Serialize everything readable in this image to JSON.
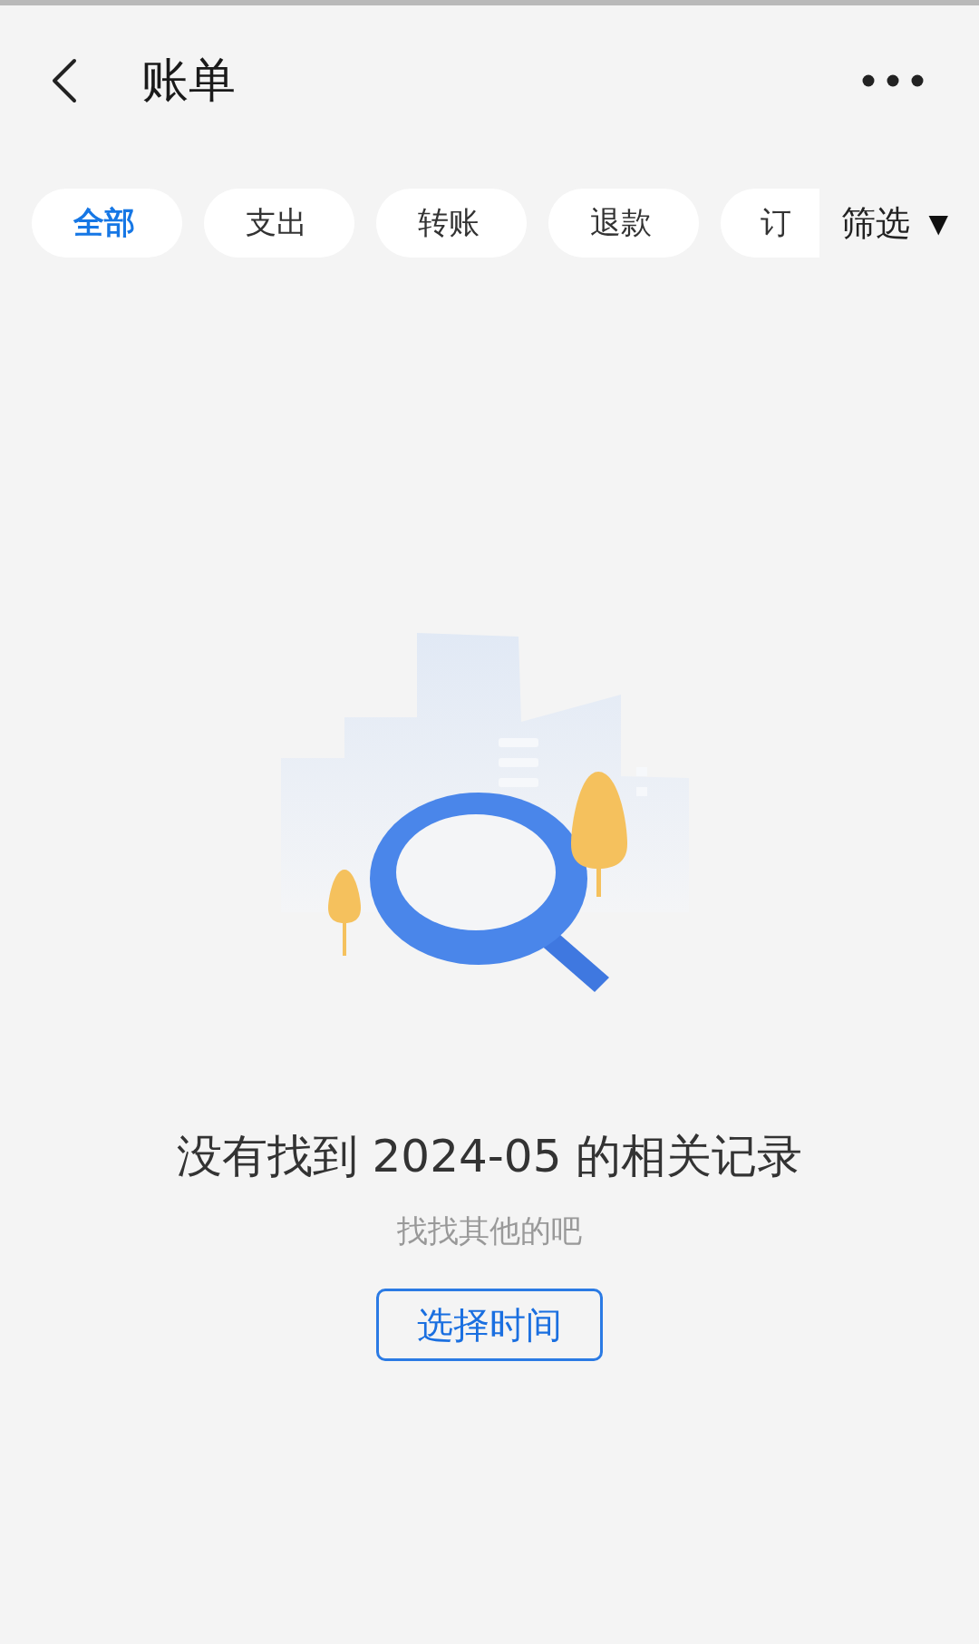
{
  "header": {
    "title": "账单"
  },
  "tabs": [
    {
      "label": "全部",
      "selected": true
    },
    {
      "label": "支出",
      "selected": false
    },
    {
      "label": "转账",
      "selected": false
    },
    {
      "label": "退款",
      "selected": false
    },
    {
      "label": "订",
      "selected": false
    }
  ],
  "filter": {
    "label": "筛选",
    "caret": "▼"
  },
  "empty_state": {
    "kind": "picture",
    "message": "没有找到 2024-05 的相关记录",
    "hint": "找找其他的吧",
    "button": "选择时间"
  }
}
